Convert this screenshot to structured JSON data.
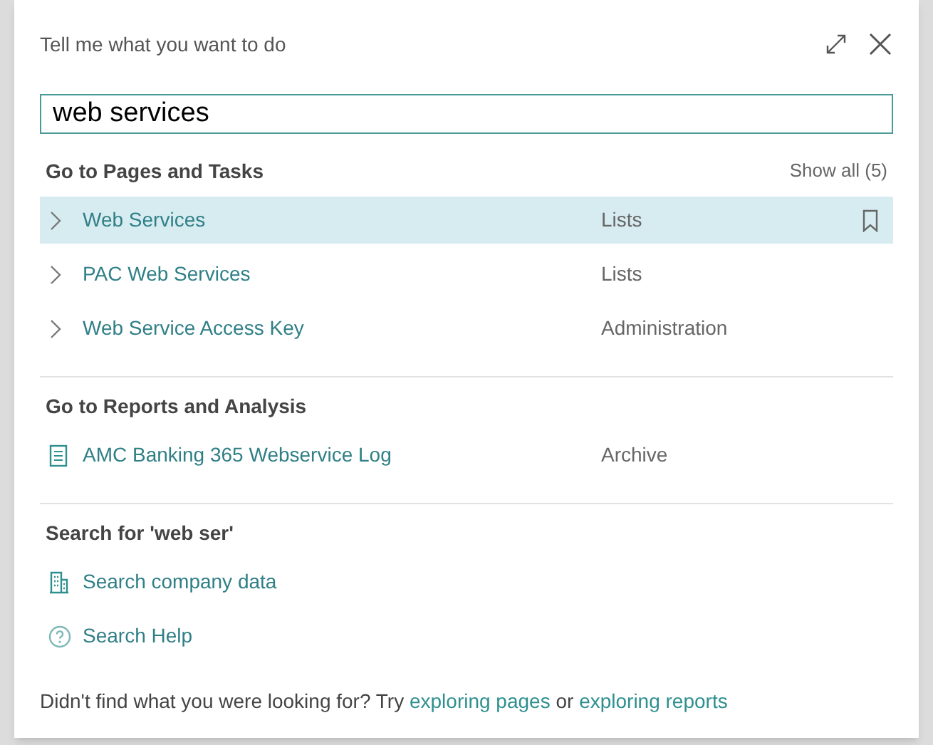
{
  "dialog": {
    "title": "Tell me what you want to do"
  },
  "search": {
    "value": "web services"
  },
  "sections": [
    {
      "heading": "Go to Pages and Tasks",
      "show_all": "Show all (5)",
      "items": [
        {
          "kind": "page",
          "label": "Web Services",
          "category": "Lists",
          "selected": true
        },
        {
          "kind": "page",
          "label": "PAC Web Services",
          "category": "Lists",
          "selected": false
        },
        {
          "kind": "page",
          "label": "Web Service Access Key",
          "category": "Administration",
          "selected": false
        }
      ]
    },
    {
      "heading": "Go to Reports and Analysis",
      "items": [
        {
          "kind": "report",
          "label": "AMC Banking 365 Webservice Log",
          "category": "Archive",
          "selected": false
        }
      ]
    },
    {
      "heading": "Search for 'web ser'",
      "items": [
        {
          "kind": "company",
          "label": "Search company data",
          "selected": false
        },
        {
          "kind": "help",
          "label": "Search Help",
          "selected": false
        }
      ]
    }
  ],
  "footer": {
    "text": "Didn't find what you were looking for? Try",
    "link_pages": "exploring pages",
    "connector": "or",
    "link_reports": "exploring reports"
  }
}
